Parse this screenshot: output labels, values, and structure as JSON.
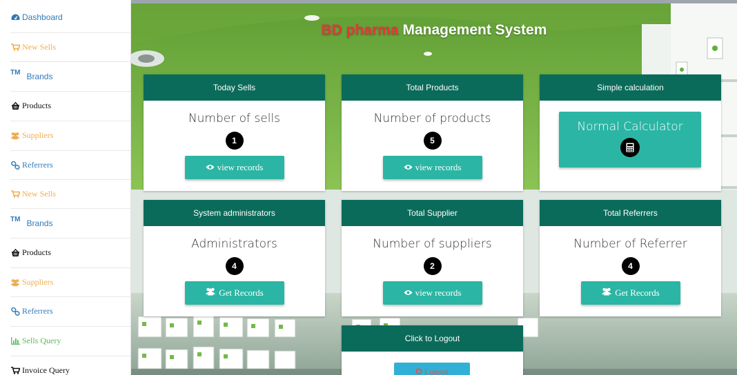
{
  "app": {
    "title_part1": "BD pharma",
    "title_part2": "Management System"
  },
  "colors": {
    "header_teal": "#0b6b5a",
    "button_teal": "#2bb5a4",
    "title_red": "#e8373a",
    "logout_blue": "#31b0d5"
  },
  "sidebar": {
    "items": [
      {
        "label": "Dashboard",
        "icon": "dashboard-icon",
        "color": "#337ab7"
      },
      {
        "label": "New Sells",
        "icon": "cart-icon",
        "color": "#f0ad4e"
      },
      {
        "label": "Brands",
        "icon": "trademark-icon",
        "icon_text": "TM",
        "color": "#337ab7"
      },
      {
        "label": "Products",
        "icon": "basket-icon",
        "color": "#111111"
      },
      {
        "label": "Suppliers",
        "icon": "users-icon",
        "color": "#f0ad4e"
      },
      {
        "label": "Referrers",
        "icon": "link-icon",
        "color": "#337ab7"
      },
      {
        "label": "New Sells",
        "icon": "cart-icon",
        "color": "#f0ad4e"
      },
      {
        "label": "Brands",
        "icon": "trademark-icon",
        "icon_text": "TM",
        "color": "#337ab7"
      },
      {
        "label": "Products",
        "icon": "basket-icon",
        "color": "#111111"
      },
      {
        "label": "Suppliers",
        "icon": "users-icon",
        "color": "#f0ad4e"
      },
      {
        "label": "Referrers",
        "icon": "link-icon",
        "color": "#337ab7"
      },
      {
        "label": "Sells Query",
        "icon": "bar-chart-icon",
        "color": "#5cb85c"
      },
      {
        "label": "Invoice Query",
        "icon": "cart-icon",
        "color": "#111111"
      }
    ]
  },
  "cards": {
    "today_sells": {
      "header": "Today Sells",
      "label": "Number of sells",
      "count": "1",
      "button": "view records"
    },
    "total_products": {
      "header": "Total Products",
      "label": "Number of products",
      "count": "5",
      "button": "view records"
    },
    "simple_calc": {
      "header": "Simple calculation",
      "button": "Normal Calculator"
    },
    "admins": {
      "header": "System administrators",
      "label": "Administrators",
      "count": "4",
      "button": "Get Records"
    },
    "total_supplier": {
      "header": "Total Supplier",
      "label": "Number of suppliers",
      "count": "2",
      "button": "view records"
    },
    "total_referrers": {
      "header": "Total Referrers",
      "label": "Number of Referrer",
      "count": "4",
      "button": "Get Records"
    },
    "logout": {
      "header": "Click to Logout",
      "button": "Logout"
    }
  }
}
